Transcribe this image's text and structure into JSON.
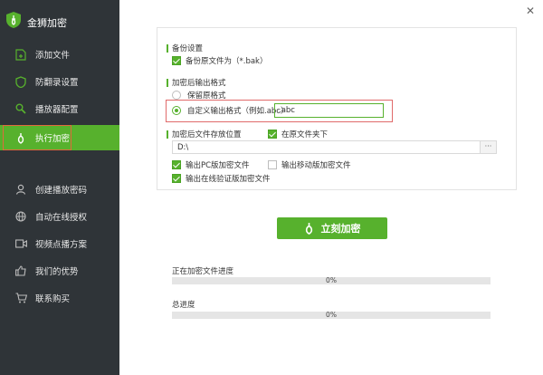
{
  "app": {
    "title": "金狮加密"
  },
  "sidebar": {
    "items": [
      {
        "label": "添加文件",
        "icon": "file-add-icon"
      },
      {
        "label": "防翻录设置",
        "icon": "shield-icon"
      },
      {
        "label": "播放器配置",
        "icon": "search-icon"
      },
      {
        "label": "执行加密",
        "icon": "flame-icon",
        "active": true
      },
      {
        "label": "创建播放密码",
        "icon": "user-icon"
      },
      {
        "label": "自动在线授权",
        "icon": "globe-icon"
      },
      {
        "label": "视频点播方案",
        "icon": "video-icon"
      },
      {
        "label": "我们的优势",
        "icon": "thumbs-up-icon"
      },
      {
        "label": "联系购买",
        "icon": "cart-icon"
      }
    ]
  },
  "window": {
    "close_glyph": "✕"
  },
  "backup": {
    "section_label": "备份设置",
    "checkbox_label": "备份原文件为（*.bak）",
    "checked": true
  },
  "output_format": {
    "section_label": "加密后输出格式",
    "keep_label": "保留原格式",
    "custom_label": "自定义输出格式（例如.abc）",
    "custom_value": ".abc",
    "selected": "custom"
  },
  "location": {
    "section_label": "加密后文件存放位置",
    "same_folder_label": "在原文件夹下",
    "same_folder_checked": true,
    "path_value": "D:\\",
    "browse_label": "···"
  },
  "options": {
    "pc_label": "输出PC版加密文件",
    "pc_checked": true,
    "mobile_label": "输出移动版加密文件",
    "mobile_checked": false,
    "online_label": "输出在线验证版加密文件",
    "online_checked": true
  },
  "action": {
    "encrypt_label": "立刻加密"
  },
  "progress": {
    "current_label": "正在加密文件进度",
    "current_value": "0%",
    "current_fraction": 0,
    "total_label": "总进度",
    "total_value": "0%",
    "total_fraction": 0
  },
  "colors": {
    "accent": "#57b12d",
    "sidebar_bg": "#2f3438",
    "highlight_border": "#e06a6a"
  }
}
